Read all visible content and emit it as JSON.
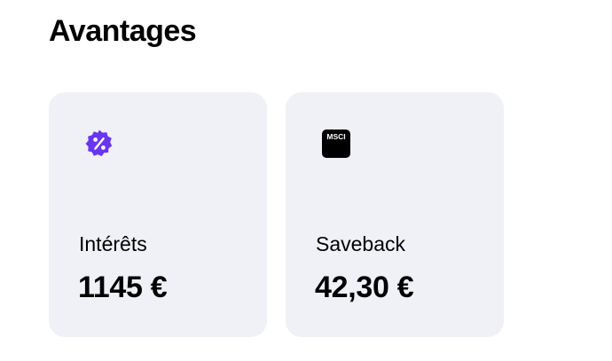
{
  "section": {
    "title": "Avantages"
  },
  "cards": [
    {
      "icon": "percent-badge-icon",
      "icon_color": "#6a35f0",
      "label": "Intérêts",
      "value": "1145 €"
    },
    {
      "icon": "msci-logo-icon",
      "icon_color": "#000000",
      "icon_text": "MSCI",
      "label": "Saveback",
      "value": "42,30 €"
    }
  ],
  "colors": {
    "card_background": "#eff1f6",
    "text": "#000000"
  }
}
